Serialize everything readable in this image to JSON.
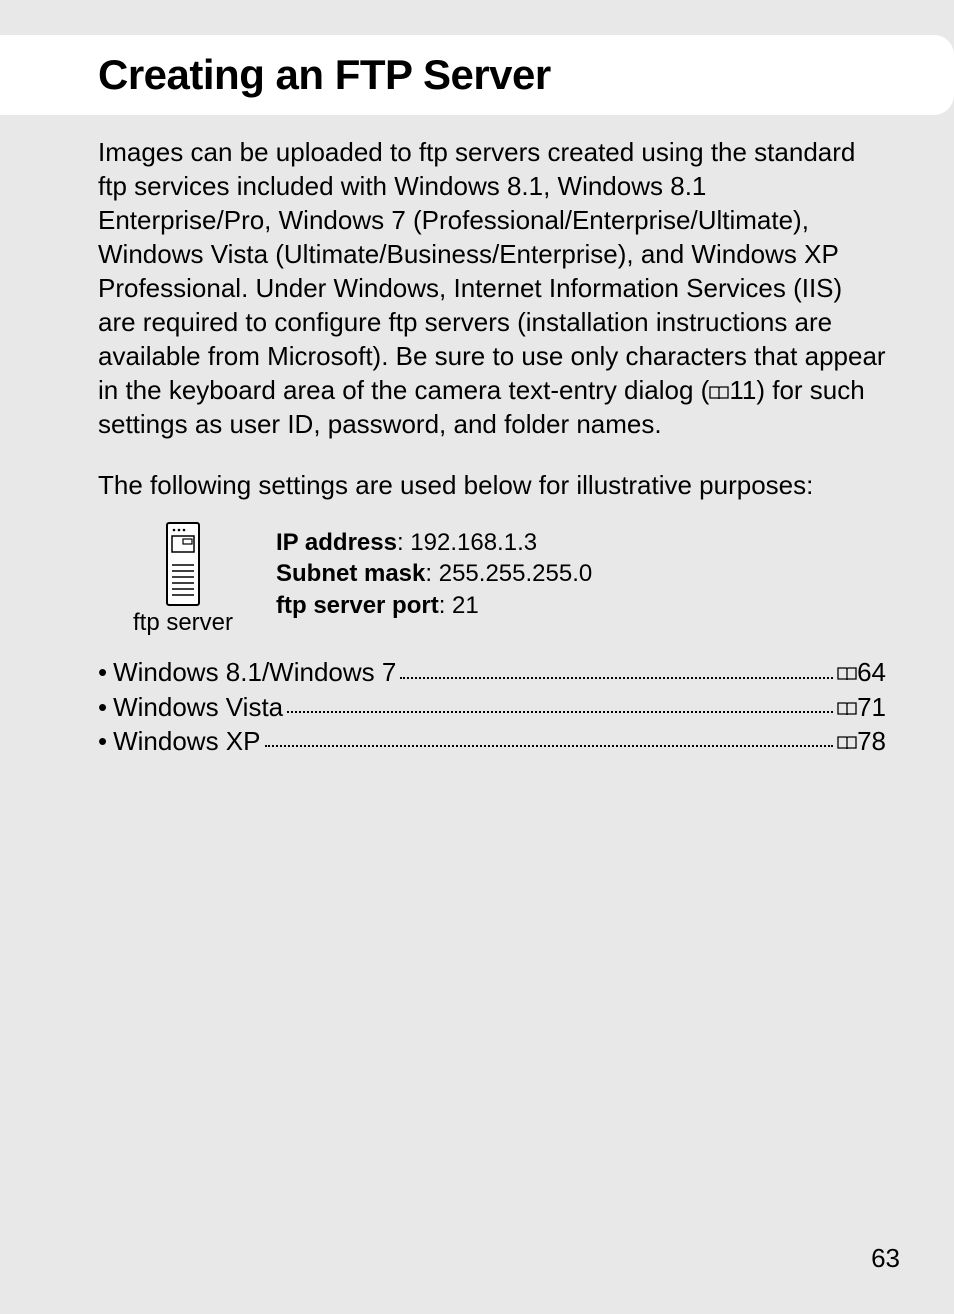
{
  "title": "Creating an FTP Server",
  "intro_before_icon": "Images can be uploaded to ftp servers created using the standard ftp services included with Windows 8.1, Windows 8.1 Enterprise/Pro, Windows 7 (Professional/Enterprise/Ultimate), Windows Vista (Ultimate/Business/Enterprise), and Windows XP Professional. Under Windows, Internet Information Services (IIS) are required to configure ftp servers (installation instructions are available from Microsoft). Be sure to use only characters that appear in the keyboard area of the camera text-entry dialog (",
  "intro_ref": "11",
  "intro_after_icon": ") for such settings as user ID, password, and folder names.",
  "illustrative_label": "The following settings are used below for illustrative purposes:",
  "server_caption": "ftp server",
  "settings": {
    "ip_label": "IP address",
    "ip_value": ": 192.168.1.3",
    "mask_label": "Subnet mask",
    "mask_value": ": 255.255.255.0",
    "port_label": "ftp server port",
    "port_value": ": 21"
  },
  "toc": [
    {
      "label": "Windows 8.1/Windows 7",
      "page": "64"
    },
    {
      "label": "Windows Vista",
      "page": "71"
    },
    {
      "label": "Windows XP",
      "page": "78"
    }
  ],
  "page_number": "63"
}
